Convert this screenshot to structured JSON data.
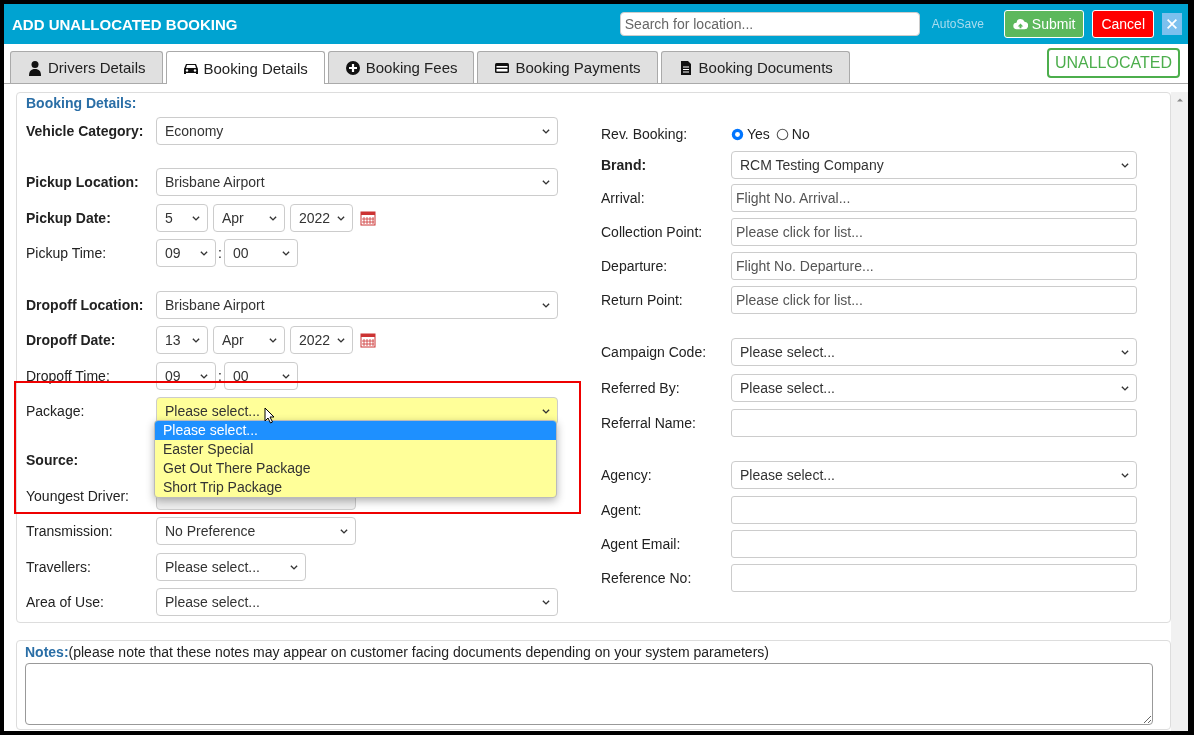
{
  "window": {
    "title": "ADD UNALLOCATED BOOKING"
  },
  "header": {
    "search": {
      "placeholder": "Search for location..."
    },
    "autosave": "AutoSave",
    "buttons": [
      {
        "label": "Submit",
        "kind": "submit"
      },
      {
        "label": "Cancel",
        "kind": "cancel"
      }
    ]
  },
  "tabs": [
    {
      "label": "Drivers Details",
      "selected": false
    },
    {
      "label": "Booking Details",
      "selected": true
    },
    {
      "label": "Booking Fees",
      "selected": false
    },
    {
      "label": "Booking Payments",
      "selected": false
    },
    {
      "label": "Booking Documents",
      "selected": false
    }
  ],
  "status_badge": "UNALLOCATED",
  "section_title": "Booking Details:",
  "left_fields": [
    {
      "label": "Vehicle Category:",
      "bold": true,
      "kind": "select",
      "value": "Economy"
    },
    {
      "label": "Pickup Location:",
      "bold": true,
      "kind": "select",
      "value": "Brisbane Airport"
    },
    {
      "label": "Pickup Date:",
      "bold": true,
      "kind": "date",
      "day": "5",
      "month": "Apr",
      "year": "2022"
    },
    {
      "label": "Pickup Time:",
      "bold": false,
      "kind": "time",
      "hour": "09",
      "separator": ":",
      "minute": "00"
    },
    {
      "label": "Dropoff Location:",
      "bold": true,
      "kind": "select",
      "value": "Brisbane Airport"
    },
    {
      "label": "Dropoff Date:",
      "bold": true,
      "kind": "date",
      "day": "13",
      "month": "Apr",
      "year": "2022"
    },
    {
      "label": "Dropoff Time:",
      "bold": false,
      "kind": "time",
      "hour": "09",
      "separator": ":",
      "minute": "00"
    },
    {
      "label": "Package:",
      "bold": false,
      "kind": "select",
      "value": "Please select...",
      "highlighted": true
    },
    {
      "label": "Source:",
      "bold": true,
      "kind": "hidden"
    },
    {
      "label": "Youngest Driver:",
      "bold": false,
      "kind": "covered"
    },
    {
      "label": "Transmission:",
      "bold": false,
      "kind": "select",
      "value": "No Preference"
    },
    {
      "label": "Travellers:",
      "bold": false,
      "kind": "select",
      "value": "Please select..."
    },
    {
      "label": "Area of Use:",
      "bold": false,
      "kind": "select",
      "value": "Please select..."
    }
  ],
  "package_dropdown": {
    "options": [
      {
        "label": "Please select...",
        "selected": true
      },
      {
        "label": "Easter Special",
        "selected": false
      },
      {
        "label": "Get Out There Package",
        "selected": false
      },
      {
        "label": "Short Trip Package",
        "selected": false
      }
    ]
  },
  "right_fields": [
    {
      "label": "Rev. Booking:",
      "bold": false,
      "kind": "radio",
      "options": [
        {
          "label": "Yes",
          "selected": true
        },
        {
          "label": "No",
          "selected": false
        }
      ]
    },
    {
      "label": "Brand:",
      "bold": true,
      "kind": "select",
      "value": "RCM Testing Company"
    },
    {
      "label": "Arrival:",
      "bold": false,
      "kind": "input",
      "placeholder": "Flight No. Arrival..."
    },
    {
      "label": "Collection Point:",
      "bold": false,
      "kind": "input",
      "placeholder": "Please click for list..."
    },
    {
      "label": "Departure:",
      "bold": false,
      "kind": "input",
      "placeholder": "Flight No. Departure..."
    },
    {
      "label": "Return Point:",
      "bold": false,
      "kind": "input",
      "placeholder": "Please click for list..."
    },
    {
      "label": "Campaign Code:",
      "bold": false,
      "kind": "select",
      "value": "Please select..."
    },
    {
      "label": "Referred By:",
      "bold": false,
      "kind": "select",
      "value": "Please select..."
    },
    {
      "label": "Referral Name:",
      "bold": false,
      "kind": "input"
    },
    {
      "label": "Agency:",
      "bold": false,
      "kind": "select",
      "value": "Please select..."
    },
    {
      "label": "Agent:",
      "bold": false,
      "kind": "input"
    },
    {
      "label": "Agent Email:",
      "bold": false,
      "kind": "input"
    },
    {
      "label": "Reference No:",
      "bold": false,
      "kind": "input"
    }
  ],
  "notes": {
    "title": "Notes:",
    "hint": "(please note that these notes may appear on customer facing documents depending on your system parameters)"
  }
}
